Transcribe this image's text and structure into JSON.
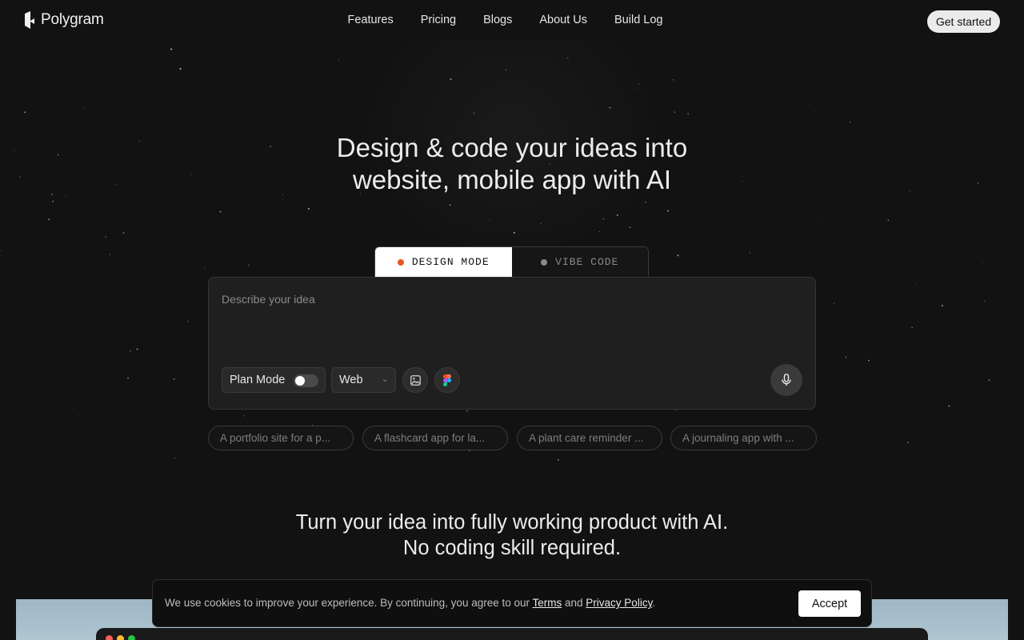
{
  "brand": {
    "name": "Polygram"
  },
  "nav": {
    "links": [
      "Features",
      "Pricing",
      "Blogs",
      "About Us",
      "Build Log"
    ],
    "cta": "Get started"
  },
  "hero": {
    "line1": "Design & code your ideas into",
    "line2": "website, mobile app with AI"
  },
  "modes": {
    "design": {
      "label": "DESIGN MODE",
      "dot_color": "#e8551f",
      "selected": true
    },
    "vibe": {
      "label": "VIBE CODE",
      "dot_color": "#8a8a8a",
      "selected": false
    }
  },
  "prompt": {
    "placeholder": "Describe your idea",
    "value": "",
    "plan_mode": {
      "label": "Plan Mode",
      "on": false
    },
    "platform": {
      "selected": "Web"
    },
    "icons": [
      "image-icon",
      "figma-icon",
      "microphone-icon"
    ]
  },
  "suggestions": [
    "A portfolio site for a p...",
    "A flashcard app for la...",
    "A plant care reminder ...",
    "A journaling app with ..."
  ],
  "subheading": {
    "line1": "Turn your idea into fully working product with AI.",
    "line2": "No coding skill required."
  },
  "cookie": {
    "text_before": "We use cookies to improve your experience. By continuing, you agree to our ",
    "terms": "Terms",
    "and": " and ",
    "privacy": "Privacy Policy",
    "end": ".",
    "accept": "Accept"
  },
  "colors": {
    "background": "#121212",
    "accent_dot": "#e8551f",
    "window_red": "#ff5f57",
    "window_yellow": "#febc2e",
    "window_green": "#28c840"
  }
}
